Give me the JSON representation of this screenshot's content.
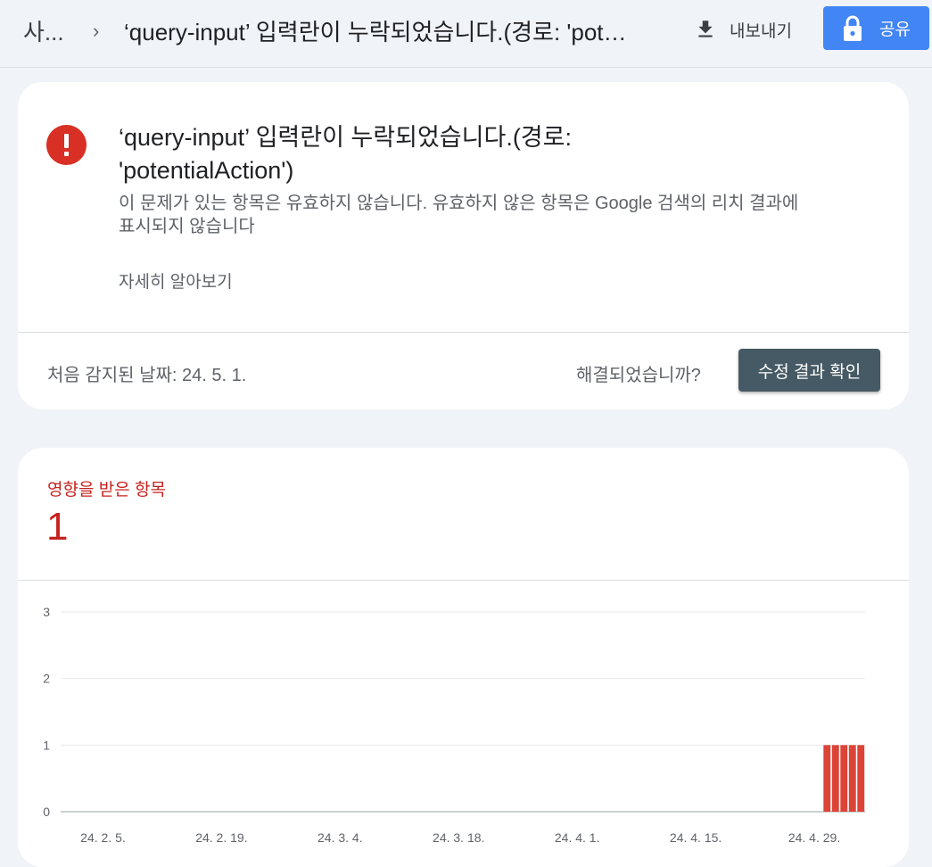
{
  "topbar": {
    "breadcrumb_root": "사...",
    "breadcrumb_sep": "›",
    "title": "‘query-input’ 입력란이 누락되었습니다.(경로: 'potentialAction')",
    "export_label": "내보내기",
    "share_label": "공유"
  },
  "issue": {
    "title": "‘query-input’ 입력란이 누락되었습니다.(경로: 'potentialAction')",
    "description": "이 문제가 있는 항목은 유효하지 않습니다. 유효하지 않은 항목은 Google 검색의 리치 결과에 표시되지 않습니다",
    "learn_more": "자세히 알아보기",
    "first_detected": "처음 감지된 날짜: 24. 5. 1.",
    "resolved_question": "해결되었습니까?",
    "validate_label": "수정 결과 확인",
    "error_color": "#d93025"
  },
  "affected": {
    "label": "영향을 받은 항목",
    "count": "1",
    "color": "#c5221f"
  },
  "chart_data": {
    "type": "bar",
    "x_ticks": [
      "24. 2. 5.",
      "24. 2. 19.",
      "24. 3. 4.",
      "24. 3. 18.",
      "24. 4. 1.",
      "24. 4. 15.",
      "24. 4. 29."
    ],
    "x_start": "2024-01-31",
    "x_end": "2024-05-05",
    "ylim": [
      0,
      3
    ],
    "y_ticks": [
      "0",
      "1",
      "2",
      "3"
    ],
    "series": [
      {
        "values": [
          {
            "x": "2024-05-01",
            "y": 1
          },
          {
            "x": "2024-05-02",
            "y": 1
          },
          {
            "x": "2024-05-03",
            "y": 1
          },
          {
            "x": "2024-05-04",
            "y": 1
          },
          {
            "x": "2024-05-05",
            "y": 1
          }
        ],
        "color": "#db4437"
      }
    ],
    "grid": true
  }
}
